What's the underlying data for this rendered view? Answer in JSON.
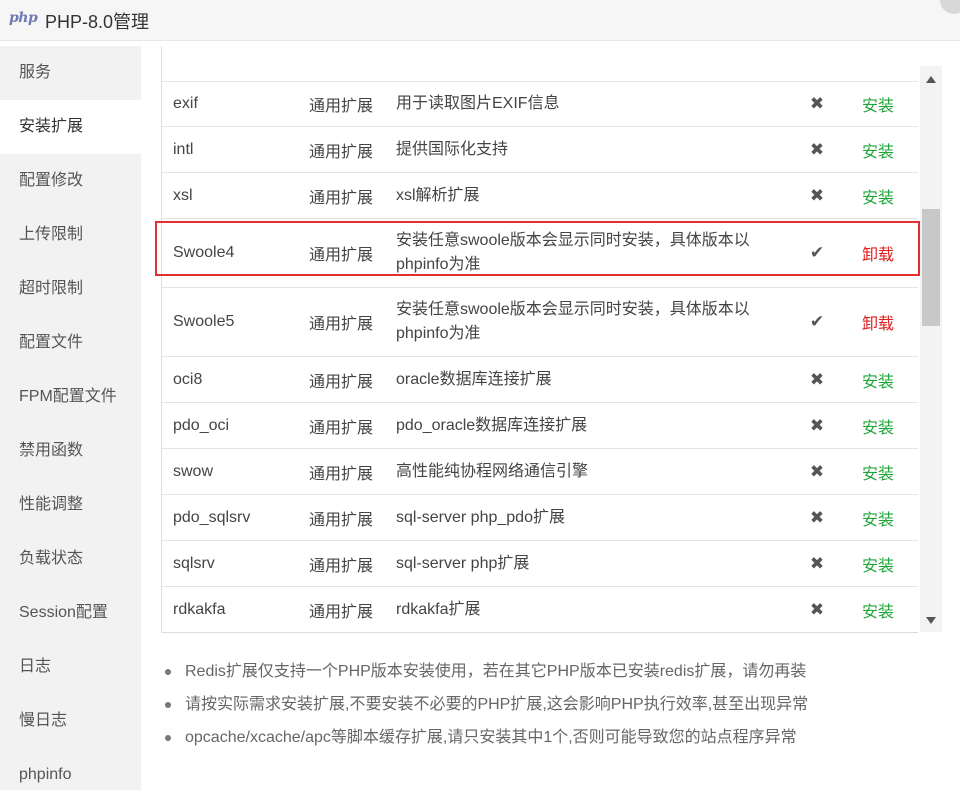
{
  "window": {
    "logo_text": "php",
    "title": "PHP-8.0管理"
  },
  "sidebar": {
    "items": [
      {
        "label": "服务"
      },
      {
        "label": "安装扩展"
      },
      {
        "label": "配置修改"
      },
      {
        "label": "上传限制"
      },
      {
        "label": "超时限制"
      },
      {
        "label": "配置文件"
      },
      {
        "label": "FPM配置文件"
      },
      {
        "label": "禁用函数"
      },
      {
        "label": "性能调整"
      },
      {
        "label": "负载状态"
      },
      {
        "label": "Session配置"
      },
      {
        "label": "日志"
      },
      {
        "label": "慢日志"
      },
      {
        "label": "phpinfo"
      }
    ],
    "active_index": 1
  },
  "extensions": {
    "rows": [
      {
        "name": "exif",
        "type": "通用扩展",
        "desc": "用于读取图片EXIF信息",
        "status_icon": "x-icon",
        "status": "✖",
        "action": "安装"
      },
      {
        "name": "intl",
        "type": "通用扩展",
        "desc": "提供国际化支持",
        "status_icon": "x-icon",
        "status": "✖",
        "action": "安装"
      },
      {
        "name": "xsl",
        "type": "通用扩展",
        "desc": "xsl解析扩展",
        "status_icon": "x-icon",
        "status": "✖",
        "action": "安装"
      },
      {
        "name": "Swoole4",
        "type": "通用扩展",
        "desc": "安装任意swoole版本会显示同时安装，具体版本以phpinfo为准",
        "status_icon": "check-icon",
        "status": "✔",
        "action": "卸载"
      },
      {
        "name": "Swoole5",
        "type": "通用扩展",
        "desc": "安装任意swoole版本会显示同时安装，具体版本以phpinfo为准",
        "status_icon": "check-icon",
        "status": "✔",
        "action": "卸载"
      },
      {
        "name": "oci8",
        "type": "通用扩展",
        "desc": "oracle数据库连接扩展",
        "status_icon": "x-icon",
        "status": "✖",
        "action": "安装"
      },
      {
        "name": "pdo_oci",
        "type": "通用扩展",
        "desc": "pdo_oracle数据库连接扩展",
        "status_icon": "x-icon",
        "status": "✖",
        "action": "安装"
      },
      {
        "name": "swow",
        "type": "通用扩展",
        "desc": "高性能纯协程网络通信引擎",
        "status_icon": "x-icon",
        "status": "✖",
        "action": "安装"
      },
      {
        "name": "pdo_sqlsrv",
        "type": "通用扩展",
        "desc": "sql-server php_pdo扩展",
        "status_icon": "x-icon",
        "status": "✖",
        "action": "安装"
      },
      {
        "name": "sqlsrv",
        "type": "通用扩展",
        "desc": "sql-server php扩展",
        "status_icon": "x-icon",
        "status": "✖",
        "action": "安装"
      },
      {
        "name": "rdkakfa",
        "type": "通用扩展",
        "desc": "rdkakfa扩展",
        "status_icon": "x-icon",
        "status": "✖",
        "action": "安装"
      }
    ]
  },
  "colors": {
    "install": "#20a53a",
    "uninstall": "#e02020",
    "highlight_border": "#e03030"
  },
  "tips": [
    "Redis扩展仅支持一个PHP版本安装使用，若在其它PHP版本已安装redis扩展，请勿再装",
    "请按实际需求安装扩展,不要安装不必要的PHP扩展,这会影响PHP执行效率,甚至出现异常",
    "opcache/xcache/apc等脚本缓存扩展,请只安装其中1个,否则可能导致您的站点程序异常"
  ]
}
